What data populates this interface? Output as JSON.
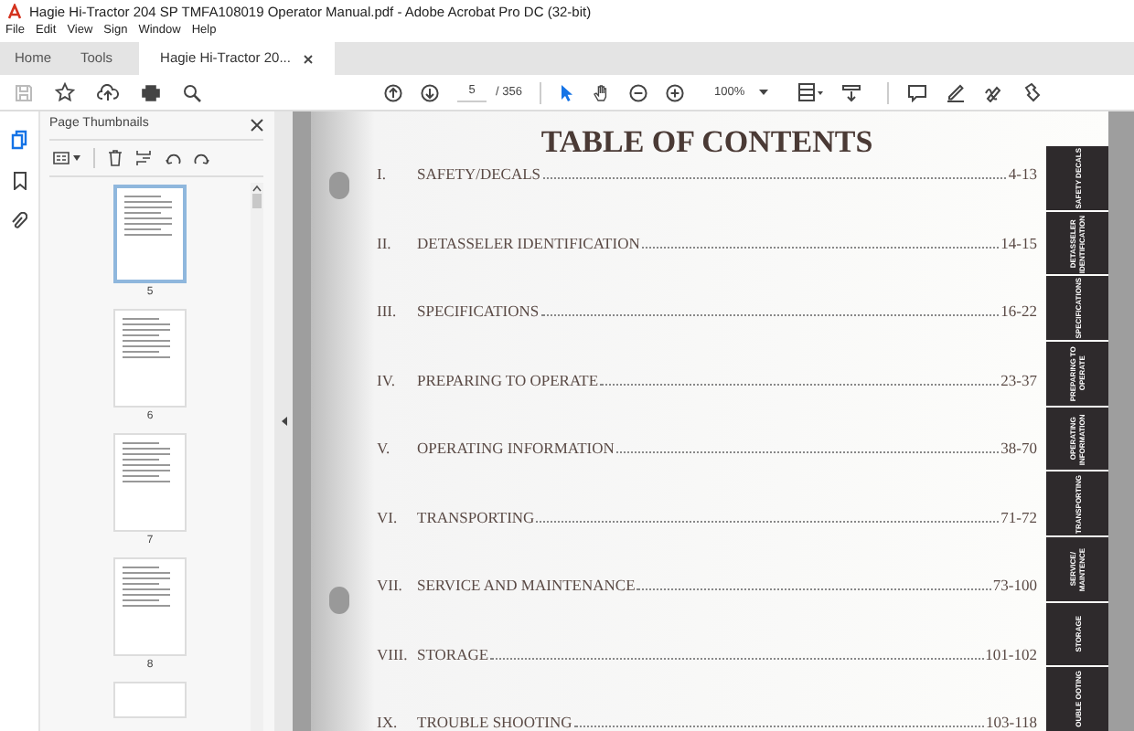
{
  "window": {
    "title": "Hagie Hi-Tractor 204 SP TMFA108019 Operator Manual.pdf - Adobe Acrobat Pro DC (32-bit)"
  },
  "menu": [
    "File",
    "Edit",
    "View",
    "Sign",
    "Window",
    "Help"
  ],
  "tabs": [
    {
      "label": "Home",
      "selected": false,
      "kind": "nav"
    },
    {
      "label": "Tools",
      "selected": false,
      "kind": "nav"
    },
    {
      "label": "Hagie Hi-Tractor 20...",
      "selected": true,
      "kind": "document"
    }
  ],
  "toolbar": {
    "page": "5",
    "page_total": "/ 356",
    "zoom": "100%"
  },
  "side_panel": {
    "title": "Page Thumbnails",
    "thumbnails": [
      {
        "label": "5",
        "selected": true
      },
      {
        "label": "6",
        "selected": false
      },
      {
        "label": "7",
        "selected": false
      },
      {
        "label": "8",
        "selected": false
      }
    ]
  },
  "document": {
    "heading": "TABLE OF CONTENTS",
    "entries": [
      {
        "number": "I.",
        "title": "SAFETY/DECALS",
        "pages": "4-13"
      },
      {
        "number": "II.",
        "title": "DETASSELER IDENTIFICATION",
        "pages": "14-15"
      },
      {
        "number": "III.",
        "title": "SPECIFICATIONS",
        "pages": "16-22"
      },
      {
        "number": "IV.",
        "title": "PREPARING TO OPERATE",
        "pages": "23-37"
      },
      {
        "number": "V.",
        "title": "OPERATING INFORMATION",
        "pages": "38-70"
      },
      {
        "number": "VI.",
        "title": "TRANSPORTING",
        "pages": "71-72"
      },
      {
        "number": "VII.",
        "title": "SERVICE AND MAINTENANCE",
        "pages": "73-100"
      },
      {
        "number": "VIII.",
        "title": "STORAGE",
        "pages": "101-102"
      },
      {
        "number": "IX.",
        "title": "TROUBLE SHOOTING",
        "pages": "103-118"
      }
    ],
    "side_tabs": [
      "SAFETY DECALS",
      "DETASSELER IDENTIFICATION",
      "SPECIFICATIONS",
      "PREPARING TO OPERATE",
      "OPERATING INFORMATION",
      "TRANSPORTING",
      "SERVICE/ MAINTENCE",
      "STORAGE",
      "OUBLE OOTING"
    ]
  }
}
